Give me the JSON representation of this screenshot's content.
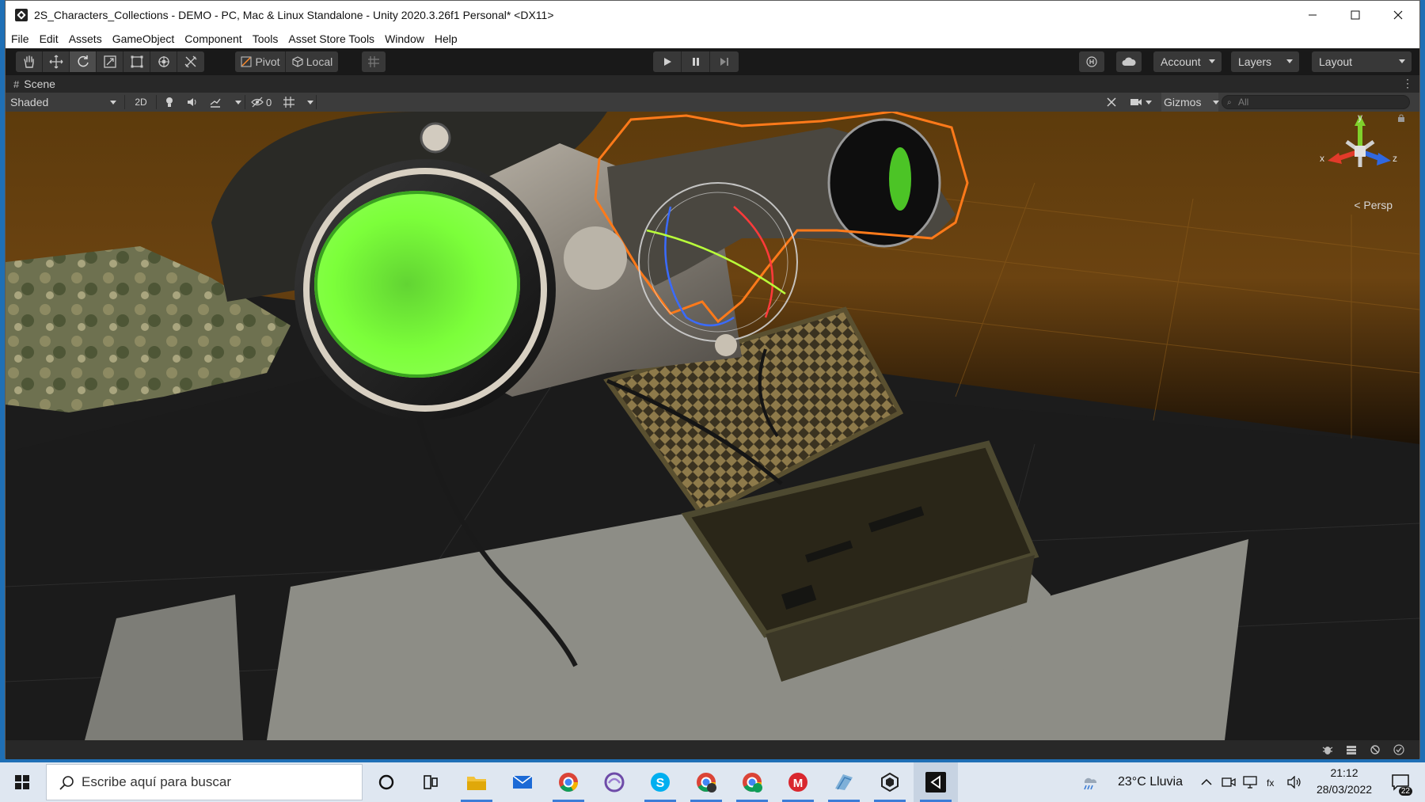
{
  "window": {
    "title": "2S_Characters_Collections - DEMO - PC, Mac & Linux Standalone - Unity 2020.3.26f1 Personal* <DX11>",
    "controls": [
      "minimize-icon",
      "maximize-icon",
      "close-icon"
    ]
  },
  "menu": {
    "items": [
      "File",
      "Edit",
      "Assets",
      "GameObject",
      "Component",
      "Tools",
      "Asset Store Tools",
      "Window",
      "Help"
    ]
  },
  "toolbar": {
    "tools": [
      "hand-tool-icon",
      "move-tool-icon",
      "rotate-tool-icon",
      "scale-tool-icon",
      "rect-tool-icon",
      "transform-tool-icon",
      "custom-tool-icon"
    ],
    "active_tool": "rotate-tool-icon",
    "pivot_label": "Pivot",
    "local_label": "Local",
    "account_label": "Account",
    "layers_label": "Layers",
    "layout_label": "Layout"
  },
  "scene": {
    "tab_label": "Scene",
    "shading_mode": "Shaded",
    "mode_2d_label": "2D",
    "hidden_count": "0",
    "gizmos_label": "Gizmos",
    "search_placeholder": "All",
    "projection_label": "< Persp",
    "axis_x": "x",
    "axis_y": "y",
    "axis_z": "z"
  },
  "taskbar": {
    "search_placeholder": "Escribe aquí para buscar",
    "pinned_apps": [
      "cortana-icon",
      "task-view-icon",
      "file-explorer-icon",
      "mail-icon",
      "chrome-icon",
      "edge-beta-icon",
      "skype-icon",
      "chrome-profile-icon",
      "chrome-profile-2-icon",
      "mega-icon",
      "files-icon",
      "unity-hub-icon",
      "visual-studio-icon"
    ],
    "weather": "23°C  Lluvia",
    "time": "21:12",
    "date": "28/03/2022",
    "notification_count": "22"
  },
  "colors": {
    "editor_dark": "#191919",
    "scene_toolbar": "#3c3c3c",
    "selection_outline": "#ff7a1a",
    "lens_green": "#7cff3a",
    "taskbar": "#dfe7f1"
  }
}
